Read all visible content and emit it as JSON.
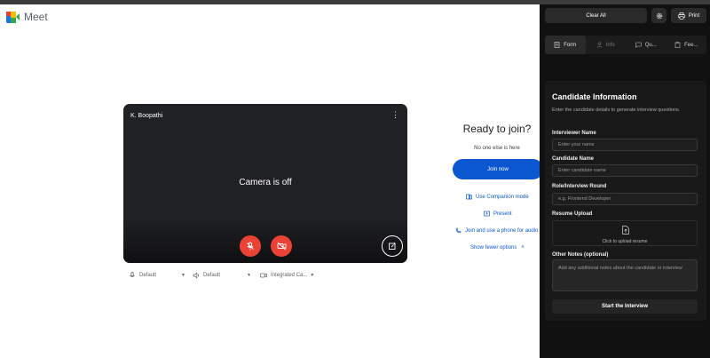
{
  "app": {
    "name": "Meet"
  },
  "preview": {
    "participant_name": "K. Boopathi",
    "camera_status": "Camera is off",
    "more_icon": "more-vert-icon",
    "mic_icon": "mic-off-icon",
    "camera_icon": "videocam-off-icon",
    "effects_icon": "visual-effects-icon"
  },
  "devices": {
    "microphone": "Default",
    "speaker": "Default",
    "camera": "Integrated Ca..."
  },
  "join": {
    "heading": "Ready to join?",
    "status": "No one else is here",
    "join_button": "Join now",
    "companion_mode": "Use Companion mode",
    "present": "Present",
    "phone_audio": "Join and use a phone for audio",
    "fewer_options": "Show fewer options"
  },
  "panel": {
    "clear_all": "Clear All",
    "print": "Print",
    "tabs": [
      {
        "label": "Form",
        "icon": "form-icon"
      },
      {
        "label": "Info",
        "icon": "person-icon"
      },
      {
        "label": "Qu...",
        "icon": "chat-icon"
      },
      {
        "label": "Fee...",
        "icon": "clipboard-icon"
      }
    ],
    "card": {
      "title": "Candidate Information",
      "subtitle": "Enter the candidate details to generate interview questions.",
      "interviewer_label": "Interviewer Name",
      "interviewer_placeholder": "Enter your name",
      "candidate_label": "Candidate Name",
      "candidate_placeholder": "Enter candidate name",
      "role_label": "Role/Interview Round",
      "role_placeholder": "e.g. Frontend Developer",
      "resume_label": "Resume Upload",
      "resume_hint": "Click to upload resume",
      "notes_label": "Other Notes (optional)",
      "notes_placeholder": "Add any additional notes about the candidate or interview",
      "start_button": "Start the Interview"
    }
  },
  "colors": {
    "accent": "#0b57d0",
    "danger": "#ea4335",
    "panel_bg": "#111111"
  }
}
